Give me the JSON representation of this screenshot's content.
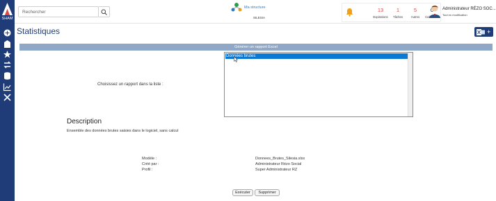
{
  "app": {
    "logo_text": "SHAM"
  },
  "sidebar": {
    "items": [
      {
        "icon": "plus-circle-icon"
      },
      {
        "icon": "building-icon"
      },
      {
        "icon": "star-icon"
      },
      {
        "icon": "transfer-icon"
      },
      {
        "icon": "database-icon"
      },
      {
        "icon": "chart-line-icon"
      },
      {
        "icon": "tools-icon"
      }
    ]
  },
  "header": {
    "search_placeholder": "Rechercher",
    "structure": {
      "title": "Ma structure",
      "subtitle": "SILESIA"
    },
    "counters": [
      {
        "value": "13",
        "label": "Expirations"
      },
      {
        "value": "1",
        "label": "Tâches"
      },
      {
        "value": "5",
        "label": "Autres"
      },
      {
        "value": "0",
        "label": "Calendrier"
      }
    ],
    "user": {
      "name": "Administrateur RÉZO SOC...",
      "status": "Tout en modification"
    }
  },
  "page": {
    "title": "Statistiques",
    "section_bar": "Générer un rapport Excel",
    "choose_label": "Choisissez un rapport dans la liste :",
    "reports": [
      "Données brutes"
    ],
    "description_title": "Description",
    "description_text": "Ensemble des données brutes saisies dans le logiciel, sans calcul",
    "meta": {
      "model_label": "Modèle :",
      "model_value": "Donnees_Brutes_Silesia.xlsx",
      "created_label": "Créé par :",
      "created_value": "Administrateur Rézo Social",
      "profile_label": "Profil :",
      "profile_value": "Super Administrateur RZ"
    },
    "buttons": {
      "execute": "Exécuter",
      "delete": "Supprimer"
    }
  },
  "colors": {
    "brand": "#1f3c78",
    "accent": "#0b78d4",
    "alert": "#e04747",
    "section": "#8fa8c7"
  }
}
